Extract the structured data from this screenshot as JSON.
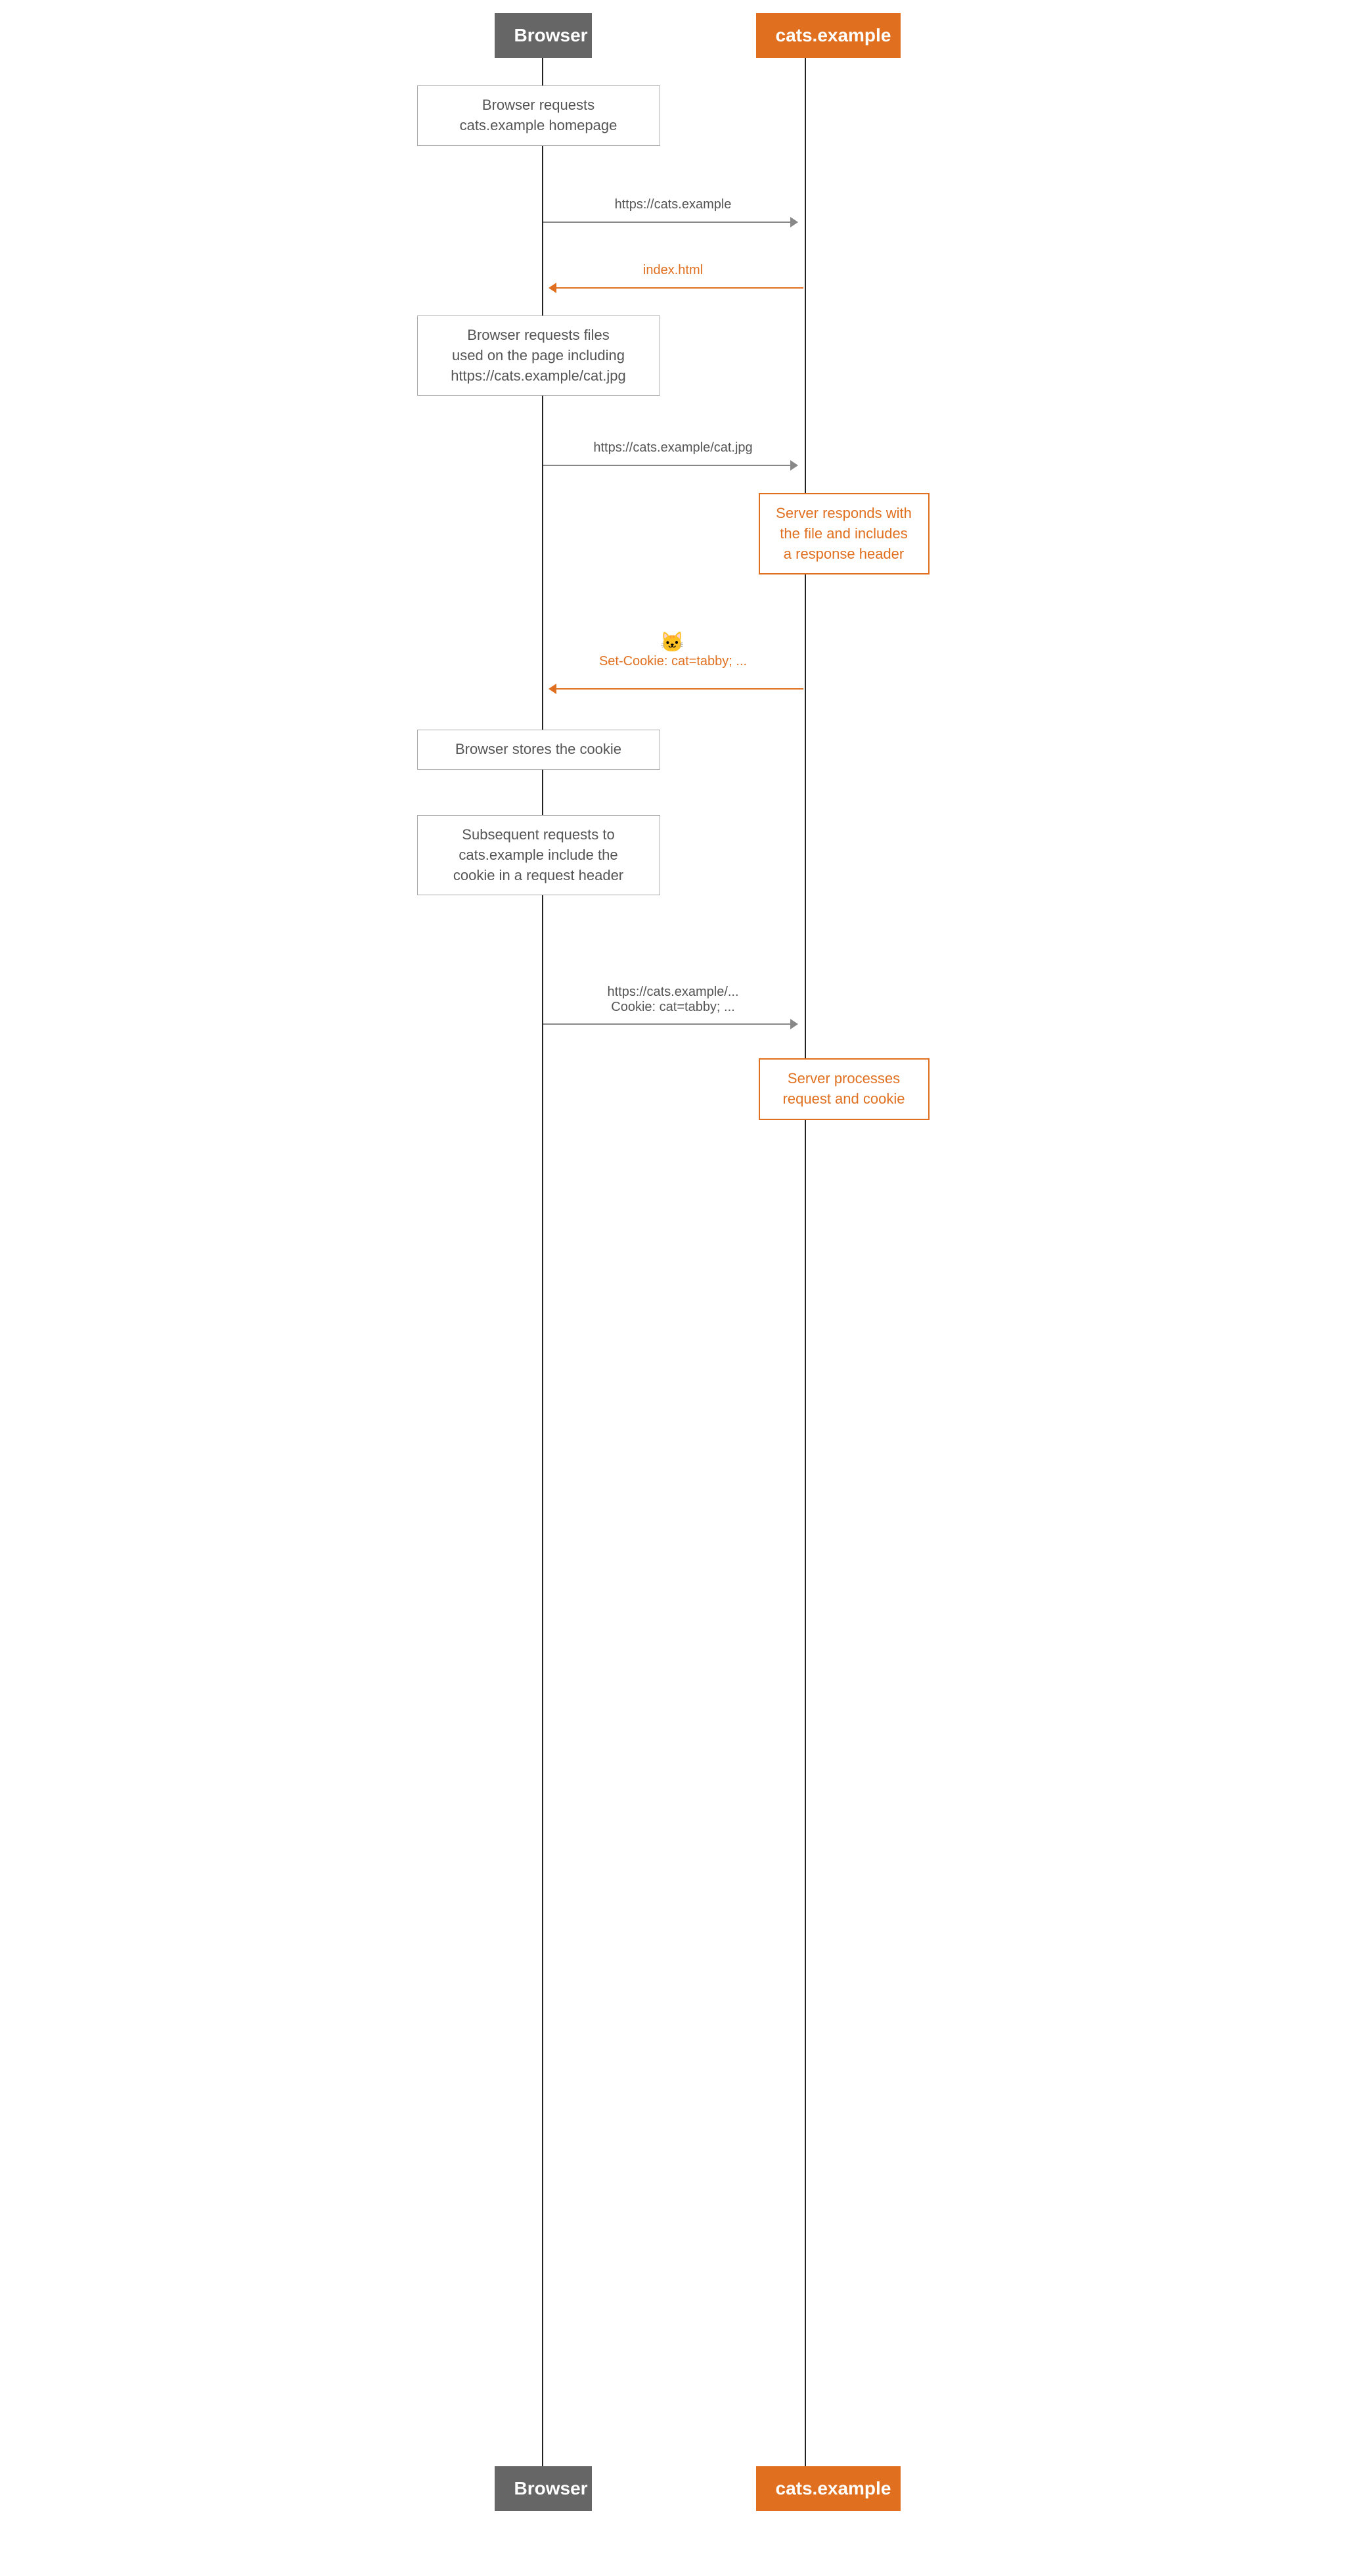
{
  "actors": {
    "browser": "Browser",
    "server": "cats.example"
  },
  "notes": {
    "browser_requests_homepage": "Browser requests\ncats.example homepage",
    "browser_requests_files": "Browser requests files\nused on the page including\nhttps://cats.example/cat.jpg",
    "server_responds_file": "Server responds with\nthe file and includes\na response header",
    "browser_stores_cookie": "Browser stores the cookie",
    "subsequent_requests": "Subsequent requests to\ncats.example include the\ncookie in a request header",
    "server_processes": "Server processes\nrequest and cookie"
  },
  "arrows": {
    "request_homepage": "https://cats.example",
    "response_index": "index.html",
    "request_cat_jpg": "https://cats.example/cat.jpg",
    "cookie_emoji": "🐱",
    "set_cookie": "Set-Cookie: cat=tabby; ...",
    "subsequent_url": "https://cats.example/...",
    "cookie_header": "Cookie: cat=tabby; ..."
  }
}
